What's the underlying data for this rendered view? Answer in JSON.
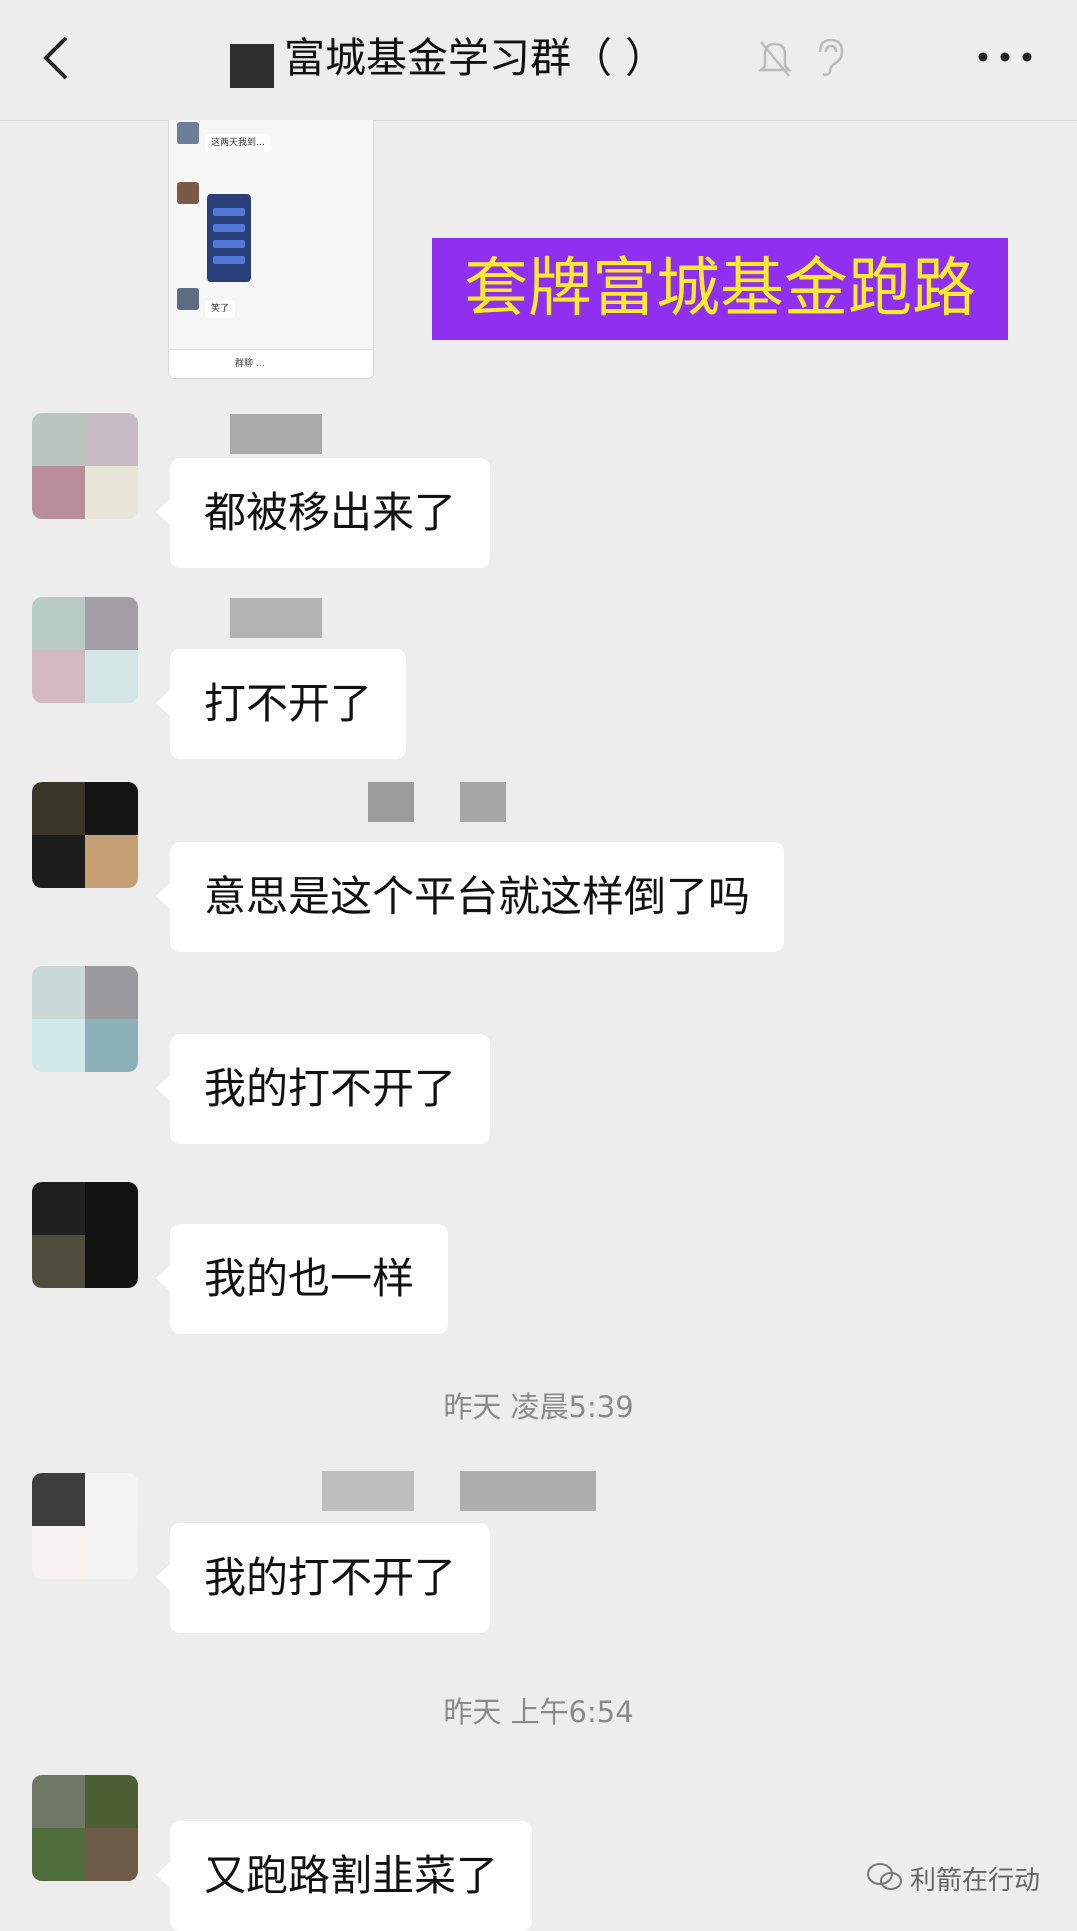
{
  "header": {
    "title": "富城基金学习群（  ）",
    "icons": [
      "back-icon",
      "mute-bell-icon",
      "ear-icon",
      "more-icon"
    ]
  },
  "shared_screenshot": {
    "message_1": "这两天我到…",
    "message_2": "笑了",
    "input_label": "群聊 …"
  },
  "banner": {
    "text": "套牌富城基金跑路",
    "background": "#8f2ff0",
    "color": "#ffea2c"
  },
  "messages": [
    {
      "text": "都被移出来了"
    },
    {
      "text": "打不开了"
    },
    {
      "text": "意思是这个平台就这样倒了吗"
    },
    {
      "text": "我的打不开了"
    },
    {
      "text": "我的也一样"
    },
    {
      "text": "我的打不开了"
    },
    {
      "text": "又跑路割韭菜了"
    }
  ],
  "timestamps": [
    "昨天 凌晨5:39",
    "昨天 上午6:54"
  ],
  "watermark": "利箭在行动"
}
